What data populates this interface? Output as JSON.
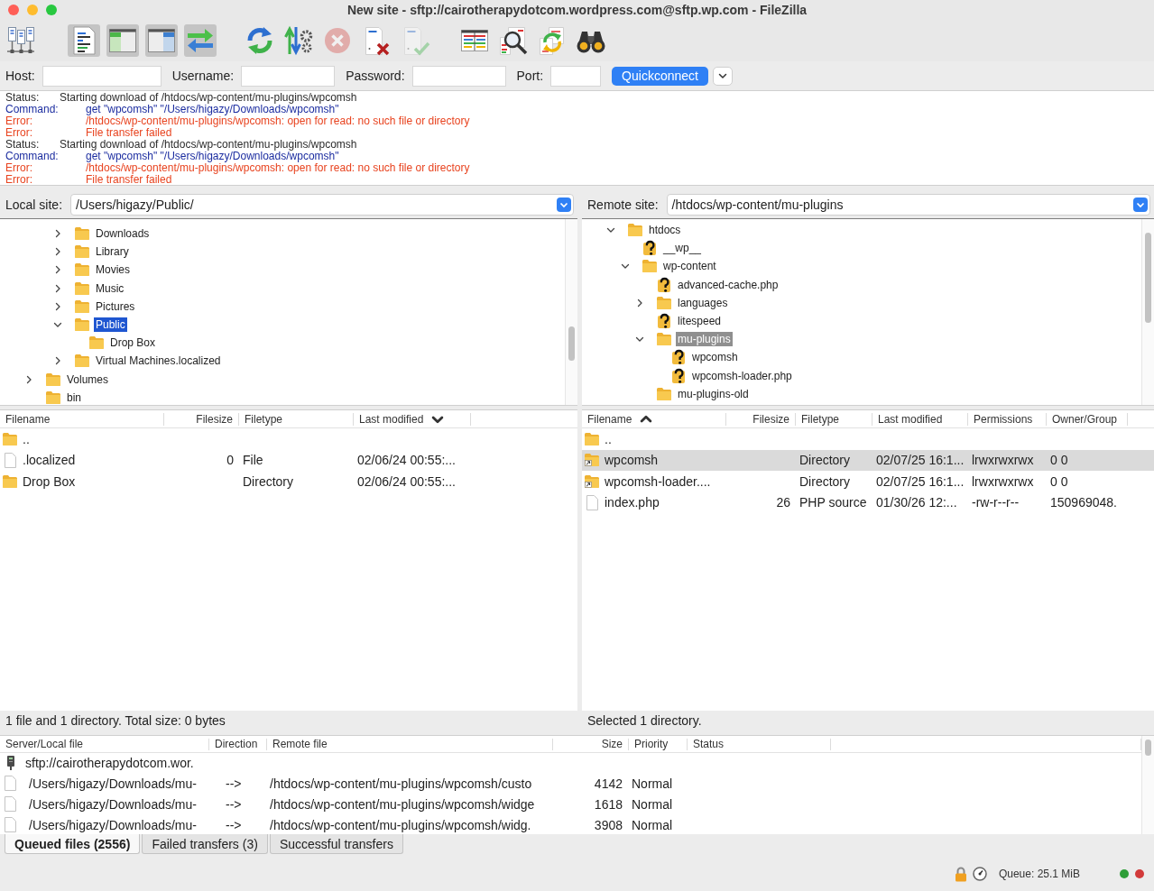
{
  "window": {
    "title": "New site - sftp://cairotherapydotcom.wordpress.com@sftp.wp.com - FileZilla"
  },
  "toolbar": {
    "groups": [
      [
        {
          "kind": "sitemanager",
          "pressed": false,
          "disabled": false
        }
      ],
      [
        {
          "kind": "log",
          "pressed": true,
          "disabled": false
        },
        {
          "kind": "localtree",
          "pressed": true,
          "disabled": false
        },
        {
          "kind": "remotetree",
          "pressed": true,
          "disabled": false
        },
        {
          "kind": "queue",
          "pressed": true,
          "disabled": false
        }
      ],
      [
        {
          "kind": "refresh",
          "pressed": false,
          "disabled": false
        },
        {
          "kind": "process",
          "pressed": false,
          "disabled": false
        },
        {
          "kind": "cancel",
          "pressed": false,
          "disabled": true
        },
        {
          "kind": "disconnect",
          "pressed": false,
          "disabled": false
        },
        {
          "kind": "reconnect",
          "pressed": false,
          "disabled": true
        }
      ],
      [
        {
          "kind": "filter",
          "pressed": false,
          "disabled": false
        },
        {
          "kind": "compare",
          "pressed": false,
          "disabled": false
        },
        {
          "kind": "sync",
          "pressed": false,
          "disabled": false
        },
        {
          "kind": "find",
          "pressed": false,
          "disabled": false
        }
      ]
    ]
  },
  "quickconnect": {
    "fields": [
      {
        "label": "Host:"
      },
      {
        "label": "Username:"
      },
      {
        "label": "Password:"
      },
      {
        "label": "Port:"
      }
    ],
    "button": "Quickconnect"
  },
  "message_log": {
    "lines": [
      {
        "kind": "status",
        "prefix": "Status:",
        "text": "Starting download of /htdocs/wp-content/mu-plugins/wpcomsh"
      },
      {
        "kind": "command",
        "prefix": "Command:",
        "text": "get \"wpcomsh\" \"/Users/higazy/Downloads/wpcomsh\""
      },
      {
        "kind": "error",
        "prefix": "Error:",
        "text": "/htdocs/wp-content/mu-plugins/wpcomsh: open for read: no such file or directory"
      },
      {
        "kind": "error",
        "prefix": "Error:",
        "text": "File transfer failed"
      },
      {
        "kind": "status",
        "prefix": "Status:",
        "text": "Starting download of /htdocs/wp-content/mu-plugins/wpcomsh"
      },
      {
        "kind": "command",
        "prefix": "Command:",
        "text": "get \"wpcomsh\" \"/Users/higazy/Downloads/wpcomsh\""
      },
      {
        "kind": "error",
        "prefix": "Error:",
        "text": "/htdocs/wp-content/mu-plugins/wpcomsh: open for read: no such file or directory"
      },
      {
        "kind": "error",
        "prefix": "Error:",
        "text": "File transfer failed"
      }
    ]
  },
  "local": {
    "site": {
      "label": "Local site:",
      "path": "/Users/higazy/Public/"
    },
    "tree": {
      "focused": true,
      "items": [
        {
          "children": [
            {
              "children": [
                {
                  "label": "Downloads",
                  "kind": "folder",
                  "expanded": false,
                  "selected": false
                },
                {
                  "label": "Library",
                  "kind": "folder",
                  "expanded": false,
                  "selected": false
                },
                {
                  "label": "Movies",
                  "kind": "folder",
                  "expanded": false,
                  "selected": false
                },
                {
                  "label": "Music",
                  "kind": "folder",
                  "expanded": false,
                  "selected": false
                },
                {
                  "label": "Pictures",
                  "kind": "folder",
                  "expanded": false,
                  "selected": false
                },
                {
                  "label": "Public",
                  "kind": "folder",
                  "expanded": true,
                  "selected": true,
                  "children": [
                    {
                      "label": "Drop Box",
                      "kind": "folder",
                      "selected": false
                    }
                  ]
                },
                {
                  "label": "Virtual Machines.localized",
                  "kind": "folder",
                  "expanded": false,
                  "selected": false
                }
              ]
            }
          ]
        },
        {
          "label": "Volumes",
          "kind": "folder",
          "expanded": false,
          "selected": false
        },
        {
          "label": "bin",
          "kind": "folder",
          "selected": false
        }
      ]
    },
    "files": {
      "columns": [
        {
          "label": "Filename",
          "sorted": false
        },
        {
          "label": "Filesize",
          "sorted": false
        },
        {
          "label": "Filetype",
          "sorted": false
        },
        {
          "label": "Last modified",
          "sorted": true,
          "descending": true
        }
      ],
      "rows": [
        {
          "kind": "parent",
          "selected": false,
          "name": ".."
        },
        {
          "kind": "file",
          "selected": false,
          "name": ".localized",
          "size": "0",
          "type": "File",
          "modified": "02/06/24 00:55:..."
        },
        {
          "kind": "folder",
          "selected": false,
          "name": "Drop Box",
          "type": "Directory",
          "modified": "02/06/24 00:55:..."
        }
      ]
    },
    "status": "1 file and 1 directory. Total size: 0 bytes"
  },
  "remote": {
    "site": {
      "label": "Remote site:",
      "path": "/htdocs/wp-content/mu-plugins"
    },
    "tree": {
      "focused": false,
      "items": [
        {
          "label": "htdocs",
          "kind": "folder",
          "expanded": true,
          "selected": false,
          "children": [
            {
              "label": "__wp__",
              "kind": "unknown",
              "selected": false
            },
            {
              "label": "wp-content",
              "kind": "folder",
              "expanded": true,
              "selected": false,
              "children": [
                {
                  "label": "advanced-cache.php",
                  "kind": "unknown",
                  "selected": false
                },
                {
                  "label": "languages",
                  "kind": "folder",
                  "expanded": false,
                  "selected": false
                },
                {
                  "label": "litespeed",
                  "kind": "unknown",
                  "selected": false
                },
                {
                  "label": "mu-plugins",
                  "kind": "folder",
                  "expanded": true,
                  "selected": true,
                  "children": [
                    {
                      "label": "wpcomsh",
                      "kind": "unknown",
                      "selected": false
                    },
                    {
                      "label": "wpcomsh-loader.php",
                      "kind": "unknown",
                      "selected": false
                    }
                  ]
                },
                {
                  "label": "mu-plugins-old",
                  "kind": "folder",
                  "selected": false
                }
              ]
            }
          ]
        }
      ]
    },
    "files": {
      "columns": [
        {
          "label": "Filename",
          "sorted": true,
          "descending": false
        },
        {
          "label": "Filesize",
          "sorted": false
        },
        {
          "label": "Filetype",
          "sorted": false
        },
        {
          "label": "Last modified",
          "sorted": false
        },
        {
          "label": "Permissions",
          "sorted": false
        },
        {
          "label": "Owner/Group",
          "sorted": false
        }
      ],
      "rows": [
        {
          "kind": "parent",
          "selected": false,
          "name": ".."
        },
        {
          "kind": "link",
          "selected": true,
          "name": "wpcomsh",
          "type": "Directory",
          "modified": "02/07/25 16:1...",
          "permissions": "lrwxrwxrwx",
          "owner_group": "0 0"
        },
        {
          "kind": "link",
          "selected": false,
          "name": "wpcomsh-loader....",
          "type": "Directory",
          "modified": "02/07/25 16:1...",
          "permissions": "lrwxrwxrwx",
          "owner_group": "0 0"
        },
        {
          "kind": "file",
          "selected": false,
          "name": "index.php",
          "size": "26",
          "type": "PHP source",
          "modified": "01/30/26 12:...",
          "permissions": "-rw-r--r--",
          "owner_group": "150969048."
        }
      ]
    },
    "status": "Selected 1 directory."
  },
  "queue": {
    "columns": [
      {
        "label": "Server/Local file"
      },
      {
        "label": "Direction"
      },
      {
        "label": "Remote file"
      },
      {
        "label": "Size"
      },
      {
        "label": "Priority"
      },
      {
        "label": "Status"
      }
    ],
    "rows": [
      {
        "kind": "server",
        "local": "sftp://cairotherapydotcom.wor."
      },
      {
        "kind": "file",
        "local": "/Users/higazy/Downloads/mu-",
        "direction": "-->",
        "remote": "/htdocs/wp-content/mu-plugins/wpcomsh/custo",
        "size": "4142",
        "priority": "Normal"
      },
      {
        "kind": "file",
        "local": "/Users/higazy/Downloads/mu-",
        "direction": "-->",
        "remote": "/htdocs/wp-content/mu-plugins/wpcomsh/widge",
        "size": "1618",
        "priority": "Normal"
      },
      {
        "kind": "file",
        "local": "/Users/higazy/Downloads/mu-",
        "direction": "-->",
        "remote": "/htdocs/wp-content/mu-plugins/wpcomsh/widg.",
        "size": "3908",
        "priority": "Normal"
      }
    ]
  },
  "queue_tabs": [
    {
      "label": "Queued files (2556)",
      "selected": true
    },
    {
      "label": "Failed transfers (3)",
      "selected": false
    },
    {
      "label": "Successful transfers",
      "selected": false
    }
  ],
  "status_bar": {
    "queue": "Queue: 25.1 MiB",
    "lights": [
      {
        "color": "#2e9e38"
      },
      {
        "color": "#d23a3a"
      }
    ]
  }
}
